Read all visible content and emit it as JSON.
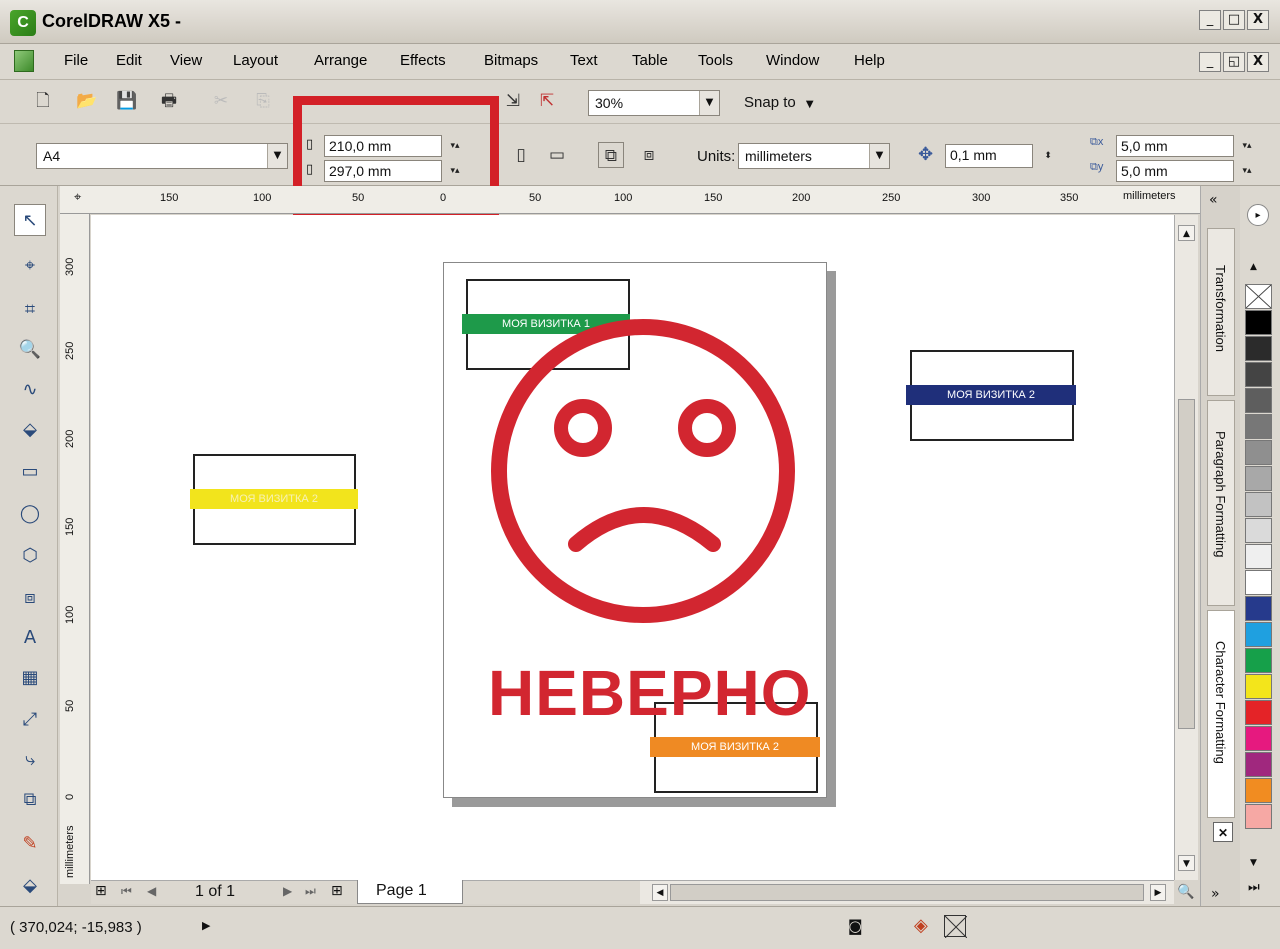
{
  "window": {
    "title": "CorelDRAW X5 -",
    "app_logo_letter": "C"
  },
  "window_controls": [
    "_",
    "□",
    "X"
  ],
  "doc_controls": [
    "_",
    "◱",
    "X"
  ],
  "menu": [
    "File",
    "Edit",
    "View",
    "Layout",
    "Arrange",
    "Effects",
    "Bitmaps",
    "Text",
    "Table",
    "Tools",
    "Window",
    "Help"
  ],
  "toolbar": {
    "zoom": "30%",
    "snap_to": "Snap to"
  },
  "property_bar": {
    "paper_size": "A4",
    "width": "210,0 mm",
    "height": "297,0 mm",
    "units_label": "Units:",
    "units_value": "millimeters",
    "nudge": "0,1 mm",
    "dup_x": "5,0 mm",
    "dup_y": "5,0 mm"
  },
  "ruler": {
    "top_labels": [
      "150",
      "100",
      "50",
      "0",
      "50",
      "100",
      "150",
      "200",
      "250",
      "300",
      "350"
    ],
    "unit": "millimeters",
    "left_labels": [
      "300",
      "250",
      "200",
      "150",
      "100",
      "50",
      "0"
    ],
    "left_unit": "millimeters"
  },
  "canvas": {
    "cards": [
      {
        "label": "МОЯ ВИЗИТКА 1",
        "color": "#1e9a4a"
      },
      {
        "label": "МОЯ ВИЗИТКА 2",
        "color": "#1f2f7a"
      },
      {
        "label": "МОЯ ВИЗИТКА 2",
        "color": "#f2e41c"
      },
      {
        "label": "МОЯ ВИЗИТКА 2",
        "color": "#ef8a23"
      }
    ],
    "error_word": "НЕВЕРНО",
    "error_color": "#d22630"
  },
  "page_nav": {
    "counter": "1 of 1",
    "tab": "Page 1"
  },
  "dockers": [
    "Transformation",
    "Paragraph Formatting",
    "Character Formatting"
  ],
  "palette": [
    "#000000",
    "#2b2b2b",
    "#444444",
    "#5e5e5e",
    "#777777",
    "#8f8f8f",
    "#a8a8a8",
    "#c2c2c2",
    "#dadada",
    "#efefef",
    "#ffffff",
    "#263a8c",
    "#1fa0e0",
    "#16a04a",
    "#f3e51b",
    "#e42327",
    "#e6197f",
    "#a0287e",
    "#f18c21",
    "#f6a8a4"
  ],
  "status": {
    "coords": "( 370,024; -15,983 )"
  },
  "icons": [
    "new-icon",
    "open-icon",
    "save-icon",
    "print-icon",
    "pick-tool-icon",
    "shape-tool-icon",
    "zoom-tool-icon",
    "text-tool-icon",
    "nudge-icon",
    "close-icon"
  ]
}
